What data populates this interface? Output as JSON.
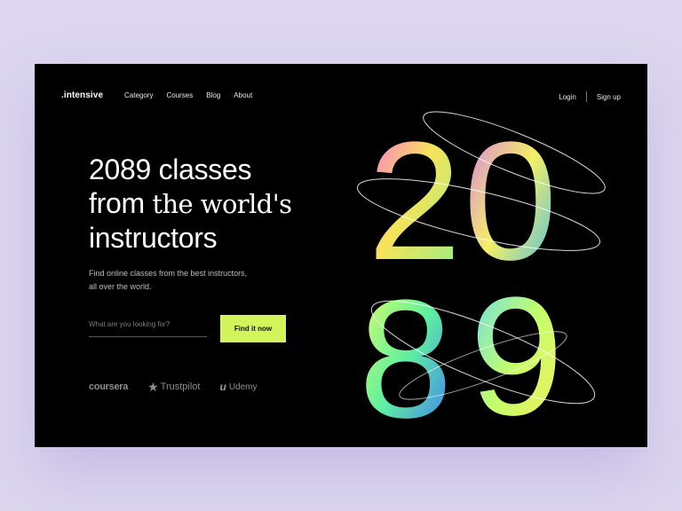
{
  "nav": {
    "logo": ".intensive",
    "menu": [
      "Category",
      "Courses",
      "Blog",
      "About"
    ],
    "login": "Login",
    "signup": "Sign up"
  },
  "hero": {
    "title_line1": "2089 classes",
    "title_line2_sans": "from",
    "title_line2_serif": "the world's",
    "title_line3": "instructors",
    "subtitle": "Find online classes from the best instructors, all over the world.",
    "art_digits": [
      "2",
      "0",
      "8",
      "9"
    ]
  },
  "search": {
    "placeholder": "What are you looking for?",
    "button_label": "Find it now"
  },
  "brands": {
    "coursera": "coursera",
    "trustpilot": "Trustpilot",
    "udemy": "Udemy"
  },
  "colors": {
    "page_bg": "#dcd7ef",
    "card_bg": "#000000",
    "accent": "#d2f55b",
    "text": "#ffffff",
    "muted": "#bdbdbd"
  }
}
